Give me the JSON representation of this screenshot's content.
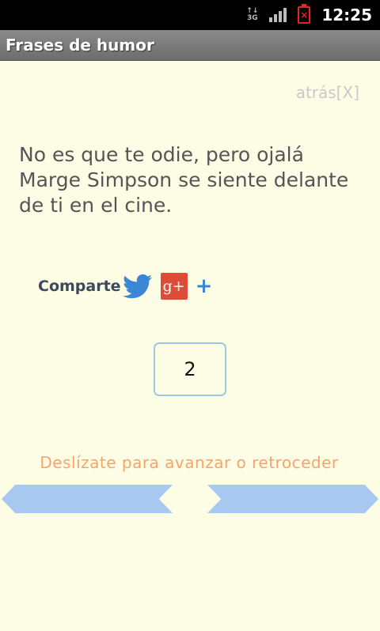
{
  "status_bar": {
    "network": "3G",
    "time": "12:25",
    "battery_icon": "battery-empty-icon",
    "signal_icon": "signal-icon"
  },
  "app": {
    "title": "Frases de humor"
  },
  "back": {
    "label": "atrás[X]"
  },
  "quote": {
    "text": "No es que te odie, pero ojalá Marge Simpson se siente delante de ti en el cine."
  },
  "share": {
    "label": "Comparte",
    "gplus_label": "g+",
    "more_label": "+"
  },
  "counter": {
    "value": "2"
  },
  "hint": {
    "text": "Deslízate para avanzar o retroceder"
  },
  "colors": {
    "background": "#fdfde6",
    "arrow": "#a7c9ef",
    "hint": "#f4a56b",
    "gplus": "#dd4b39",
    "twitter": "#3b87d5"
  }
}
